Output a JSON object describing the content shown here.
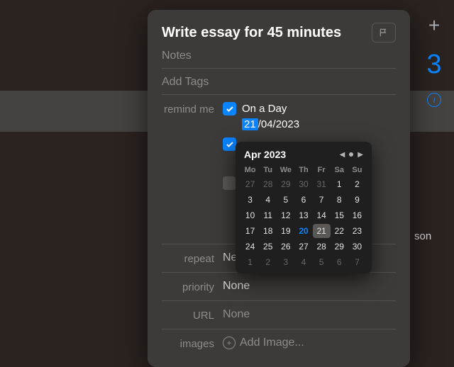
{
  "rightbar": {
    "plus": "+",
    "number": "3",
    "info": "i"
  },
  "bg": {
    "partial_text": "son"
  },
  "panel": {
    "title": "Write essay for 45 minutes",
    "notes_placeholder": "Notes",
    "tags_placeholder": "Add Tags",
    "remind_label": "remind me",
    "remind_option": "On a Day",
    "date_selected": "21",
    "date_rest": "/04/2023",
    "repeat_label": "repeat",
    "repeat_value": "Ne",
    "priority_label": "priority",
    "priority_value": "None",
    "url_label": "URL",
    "url_value": "None",
    "images_label": "images",
    "images_value": "Add Image..."
  },
  "calendar": {
    "title": "Apr 2023",
    "dayheads": [
      "Mo",
      "Tu",
      "We",
      "Th",
      "Fr",
      "Sa",
      "Su"
    ],
    "lead_muted": [
      "27",
      "28",
      "29",
      "30",
      "31"
    ],
    "days": [
      "1",
      "2",
      "3",
      "4",
      "5",
      "6",
      "7",
      "8",
      "9",
      "10",
      "11",
      "12",
      "13",
      "14",
      "15",
      "16",
      "17",
      "18",
      "19",
      "20",
      "21",
      "22",
      "23",
      "24",
      "25",
      "26",
      "27",
      "28",
      "29",
      "30"
    ],
    "trail_muted": [
      "1",
      "2",
      "3",
      "4",
      "5",
      "6",
      "7"
    ],
    "today": "20",
    "selected": "21"
  }
}
